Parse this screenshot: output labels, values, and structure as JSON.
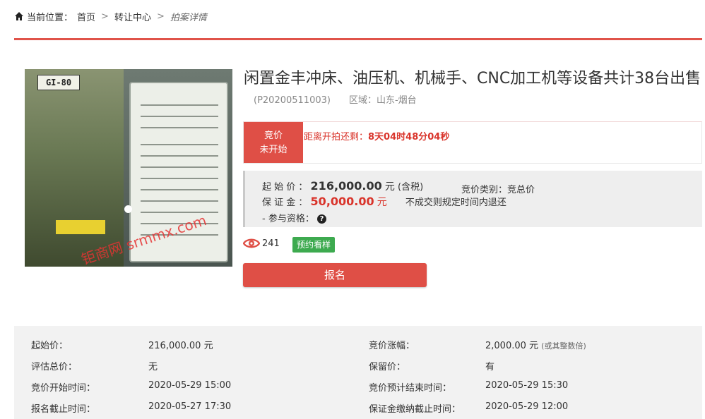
{
  "breadcrumb": {
    "label": "当前位置：",
    "home": "首页",
    "sep": ">",
    "center": "转让中心",
    "current": "拍案详情"
  },
  "product": {
    "title": "闲置金丰冲床、油压机、机械手、CNC加工机等设备共计38台出售",
    "code": "(P20200511003)",
    "region": "区域：山东-烟台",
    "image_plate_text": "GI-80",
    "watermark": "钜商网 srmmx.com"
  },
  "auction": {
    "status_line1": "竞价",
    "status_line2": "未开始",
    "countdown_label": "距离开拍还剩：",
    "countdown_value": "8天04时48分04秒"
  },
  "price": {
    "start_label": "起 始 价 ：",
    "start_value": "216,000.00",
    "start_unit": "元",
    "start_tax": "(含税)",
    "type_label": "竞价类别：",
    "type_value": "竞总价",
    "deposit_label": "保 证 金 ：",
    "deposit_value": "50,000.00",
    "deposit_unit": "元",
    "deposit_note": "不成交则规定时间内退还",
    "qual_label": "- 参与资格：",
    "qual_icon": "?"
  },
  "stats": {
    "views": "241",
    "sample_button": "预约看样"
  },
  "actions": {
    "signup": "报名"
  },
  "details": {
    "left": [
      {
        "label": "起始价：",
        "value": "216,000.00 元"
      },
      {
        "label": "评估总价：",
        "value": "无"
      },
      {
        "label": "竞价开始时间：",
        "value": "2020-05-29 15:00"
      },
      {
        "label": "报名截止时间：",
        "value": "2020-05-27 17:30"
      }
    ],
    "right": [
      {
        "label": "竞价涨幅：",
        "value": "2,000.00 元",
        "note": "(或其整数倍)"
      },
      {
        "label": "保留价：",
        "value": "有"
      },
      {
        "label": "竞价预计结束时间：",
        "value": "2020-05-29 15:30"
      },
      {
        "label": "保证金缴纳截止时间：",
        "value": "2020-05-29 12:00"
      }
    ]
  },
  "colors": {
    "accent_red": "#df4f46",
    "green": "#3daa4f"
  }
}
